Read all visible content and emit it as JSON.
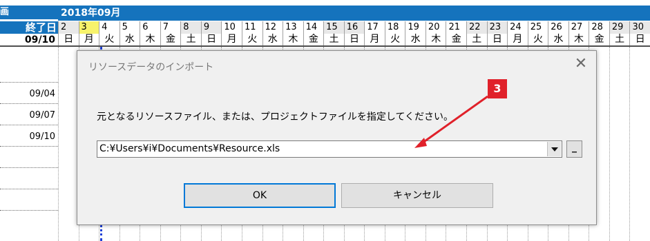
{
  "gantt": {
    "left_top_partial": "画",
    "left_header": "終了日",
    "left_date_header": "09/10",
    "row_dates": [
      "",
      "09/04",
      "09/07",
      "09/10",
      "",
      "",
      ""
    ],
    "month_label": "2018年09月",
    "days": [
      "2",
      "3",
      "4",
      "5",
      "6",
      "7",
      "8",
      "9",
      "10",
      "11",
      "12",
      "13",
      "14",
      "15",
      "16",
      "17",
      "18",
      "19",
      "20",
      "21",
      "22",
      "23",
      "24",
      "25",
      "26",
      "27",
      "28",
      "29",
      "30"
    ],
    "weekdays": [
      "日",
      "月",
      "火",
      "水",
      "木",
      "金",
      "土",
      "日",
      "月",
      "火",
      "水",
      "木",
      "金",
      "土",
      "日",
      "月",
      "火",
      "水",
      "木",
      "金",
      "土",
      "日",
      "月",
      "火",
      "水",
      "木",
      "金",
      "土",
      "日"
    ],
    "today_day": "3"
  },
  "dialog": {
    "title": "リソースデータのインポート",
    "close_glyph": "✕",
    "prompt": "元となるリソースファイル、または、プロジェクトファイルを指定してください。",
    "file_path": "C:¥Users¥i¥Documents¥Resource.xls",
    "browse_label": "_",
    "ok_label": "OK",
    "cancel_label": "キャンセル"
  },
  "annotation": {
    "badge_number": "3",
    "color": "#e0212a"
  }
}
